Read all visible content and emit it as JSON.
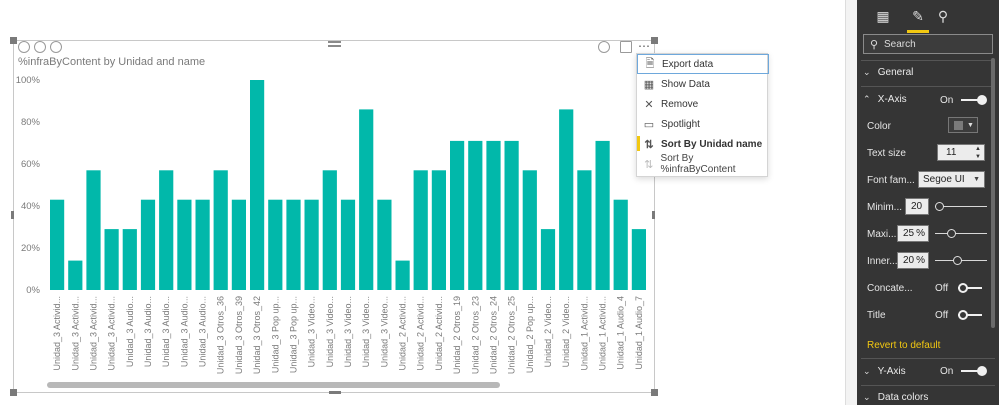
{
  "visual": {
    "title": "%infraByContent by Unidad and name",
    "y_ticks": [
      "0%",
      "20%",
      "40%",
      "60%",
      "80%",
      "100%"
    ]
  },
  "chart_data": {
    "type": "bar",
    "title": "%infraByContent by Unidad and name",
    "xlabel": "",
    "ylabel": "",
    "ylim": [
      0,
      100
    ],
    "y_format": "percent",
    "bar_color": "#01b8aa",
    "categories": [
      "Unidad_3 Activid...",
      "Unidad_3 Activid...",
      "Unidad_3 Activid...",
      "Unidad_3 Activid...",
      "Unidad_3 Audio...",
      "Unidad_3 Audio...",
      "Unidad_3 Audio...",
      "Unidad_3 Audio...",
      "Unidad_3 Audio...",
      "Unidad_3 Otros_36",
      "Unidad_3 Otros_39",
      "Unidad_3 Otros_42",
      "Unidad_3 Pop up...",
      "Unidad_3 Pop up...",
      "Unidad_3 Video...",
      "Unidad_3 Video...",
      "Unidad_3 Video...",
      "Unidad_3 Video...",
      "Unidad_3 Video...",
      "Unidad_2 Activid...",
      "Unidad_2 Activid...",
      "Unidad_2 Activid...",
      "Unidad_2 Otros_19",
      "Unidad_2 Otros_23",
      "Unidad_2 Otros_24",
      "Unidad_2 Otros_25",
      "Unidad_2 Pop up...",
      "Unidad_2 Video...",
      "Unidad_2 Video...",
      "Unidad_1 Activid...",
      "Unidad_1 Activid...",
      "Unidad_1 Audio_4",
      "Unidad_1 Audio_7"
    ],
    "values": [
      43,
      14,
      57,
      29,
      29,
      43,
      57,
      43,
      43,
      57,
      43,
      100,
      43,
      43,
      43,
      57,
      43,
      86,
      43,
      14,
      57,
      57,
      71,
      71,
      71,
      71,
      57,
      29,
      86,
      57,
      71,
      43,
      29
    ]
  },
  "menu": {
    "items": [
      {
        "label": "Export data",
        "icon": "document-icon"
      },
      {
        "label": "Show Data",
        "icon": "table-icon"
      },
      {
        "label": "Remove",
        "icon": "close-icon"
      },
      {
        "label": "Spotlight",
        "icon": "spotlight-icon"
      },
      {
        "label": "Sort By Unidad name",
        "icon": "sort-az-icon"
      },
      {
        "label": "Sort By %infraByContent",
        "icon": "sort-az-icon"
      }
    ]
  },
  "pane": {
    "search_placeholder": "Search",
    "general_label": "General",
    "xaxis_label": "X-Axis",
    "xaxis_state": "On",
    "color_label": "Color",
    "textsize_label": "Text size",
    "textsize_value": "11",
    "fontfam_label": "Font fam...",
    "fontfam_value": "Segoe UI",
    "minim_label": "Minim...",
    "minim_value": "20",
    "maxi_label": "Maxi...",
    "maxi_value": "25",
    "maxi_unit": "%",
    "inner_label": "Inner...",
    "inner_value": "20",
    "inner_unit": "%",
    "concat_label": "Concate...",
    "concat_state": "Off",
    "title_label": "Title",
    "title_state": "Off",
    "revert_label": "Revert to default",
    "yaxis_label": "Y-Axis",
    "yaxis_state": "On",
    "datacolors_label": "Data colors",
    "accent_color": "#f2c811"
  }
}
